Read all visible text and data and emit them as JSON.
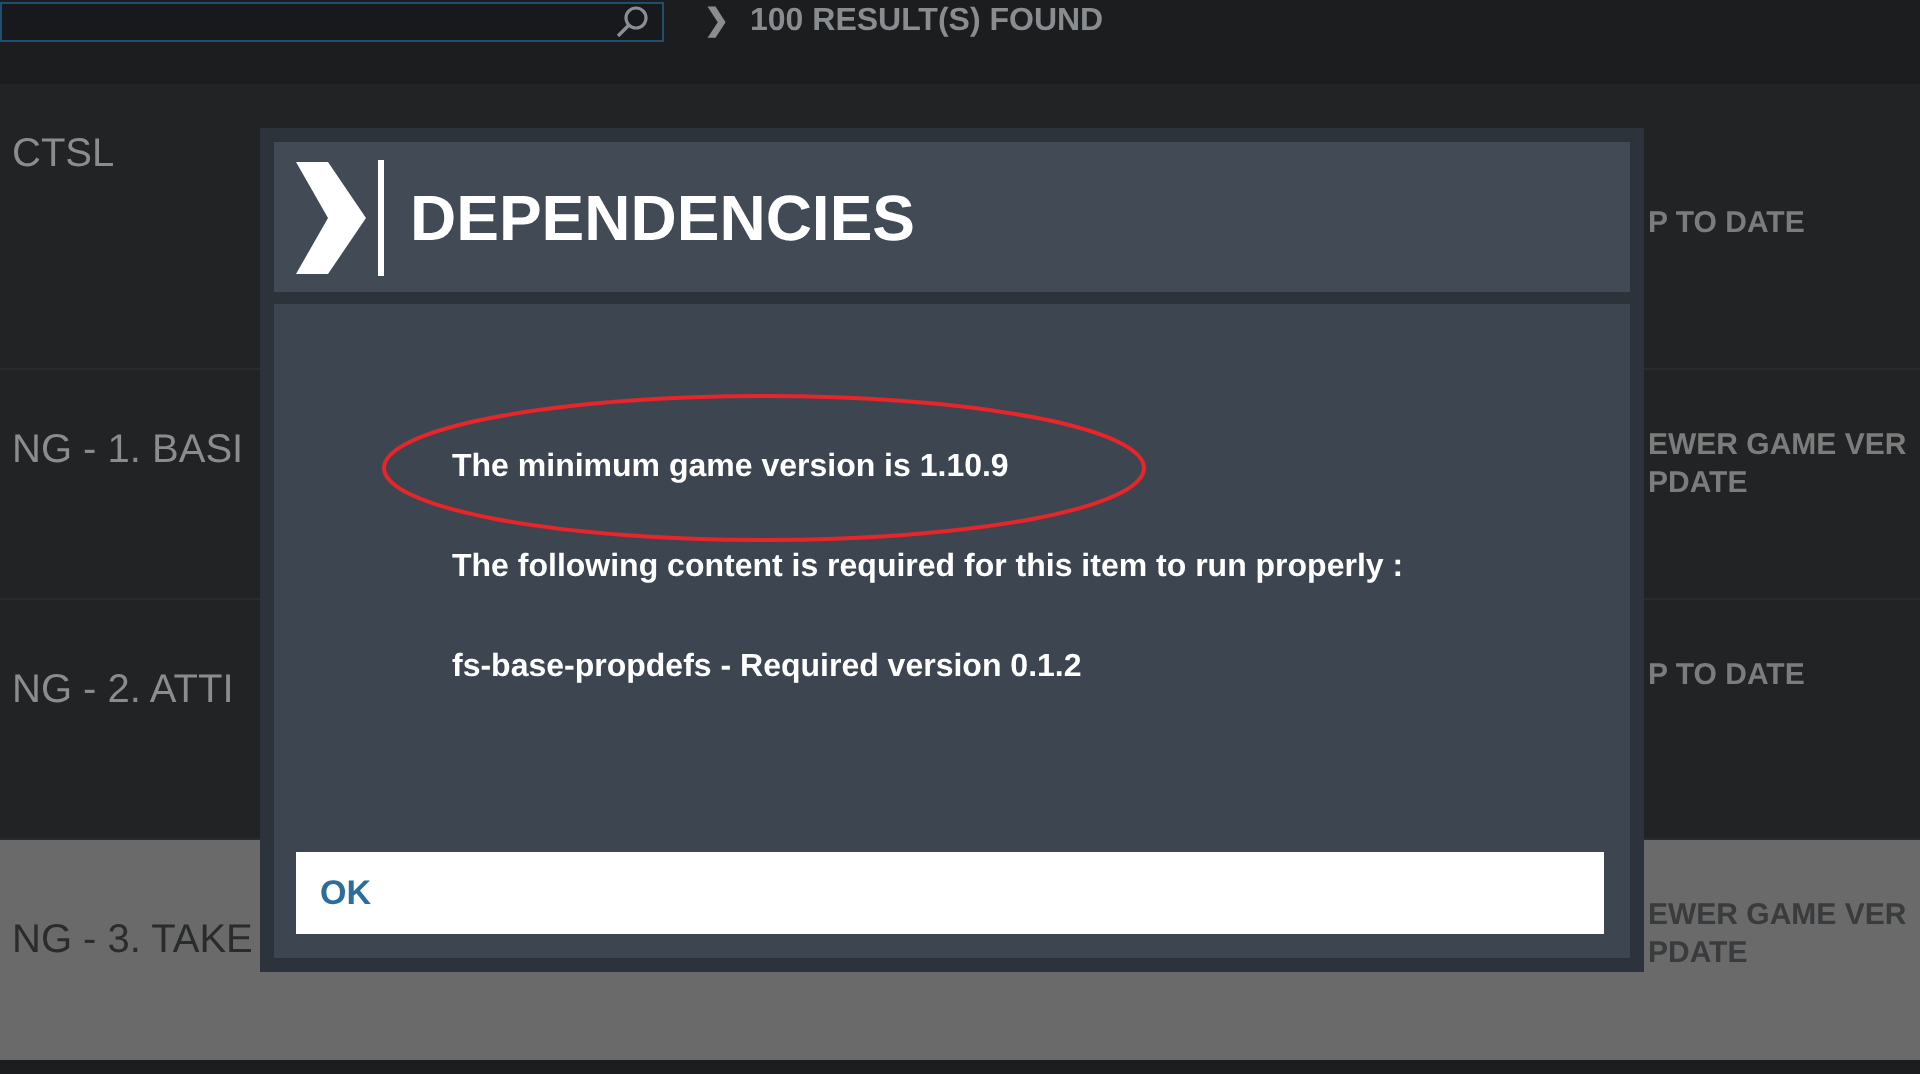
{
  "results": {
    "chevron": "❯",
    "text": "100 RESULT(S) FOUND"
  },
  "list": {
    "rows": [
      {
        "title": "CTSL",
        "status": [
          "P TO DATE"
        ],
        "selected": false
      },
      {
        "title": "NG - 1. BASI",
        "status": [
          "EWER GAME VER",
          "PDATE"
        ],
        "selected": false
      },
      {
        "title": "NG - 2. ATTI",
        "status": [
          "P TO DATE"
        ],
        "selected": false
      },
      {
        "title": "NG - 3. TAKE",
        "status": [
          "EWER GAME VER",
          "PDATE"
        ],
        "selected": true
      }
    ]
  },
  "dialog": {
    "title": "DEPENDENCIES",
    "lines": [
      {
        "text": "The minimum game version is 1.10.9",
        "circled": true
      },
      {
        "text": "The following content is required for this item to run properly :",
        "circled": false
      },
      {
        "text": "fs-base-propdefs - Required version 0.1.2",
        "circled": false
      }
    ],
    "button": "OK"
  }
}
